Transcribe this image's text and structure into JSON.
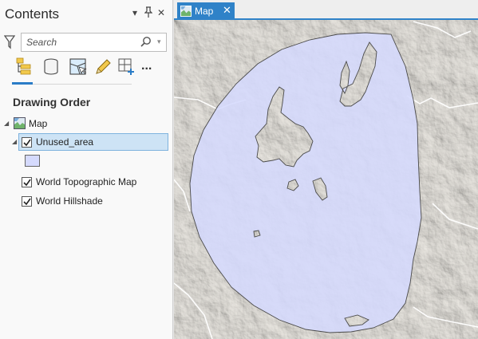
{
  "contents": {
    "title": "Contents",
    "search": {
      "placeholder": "Search"
    },
    "section_title": "Drawing Order",
    "toolbar": {
      "icons": [
        "list-by-drawing-order-icon",
        "list-by-data-source-icon",
        "list-by-selection-icon",
        "list-by-editing-icon",
        "list-by-snapping-icon",
        "more-icon"
      ],
      "more_label": "..."
    },
    "tree": {
      "map_label": "Map",
      "layers": [
        {
          "label": "Unused_area",
          "checked": true,
          "selected": true,
          "symbol_color": "#d5dafd"
        },
        {
          "label": "World Topographic Map",
          "checked": true
        },
        {
          "label": "World Hillshade",
          "checked": true
        }
      ]
    }
  },
  "map_view": {
    "tab_label": "Map",
    "close_label": "✕"
  },
  "colors": {
    "accent": "#2f82c8",
    "selection": "#cde3f5",
    "polygon_fill": "#d5dafd",
    "terrain_base": "#e8e5df"
  }
}
